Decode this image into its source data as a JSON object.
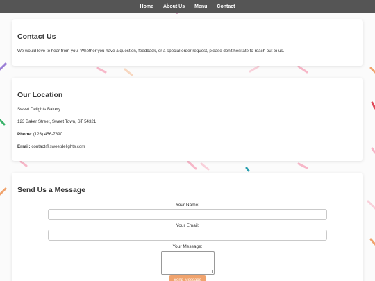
{
  "nav": {
    "items": [
      {
        "label": "Home"
      },
      {
        "label": "About Us"
      },
      {
        "label": "Menu"
      },
      {
        "label": "Contact"
      }
    ]
  },
  "contact": {
    "title": "Contact Us",
    "text": "We would love to hear from you! Whether you have a question, feedback, or a special order request, please don't hesitate to reach out to us."
  },
  "location": {
    "title": "Our Location",
    "name": "Sweet Delights Bakery",
    "address": "123 Baker Street, Sweet Town, ST 54321",
    "phone_label": "Phone:",
    "phone": "(123) 456-7890",
    "email_label": "Email:",
    "email": "contact@sweetdelights.com"
  },
  "message_form": {
    "title": "Send Us a Message",
    "name_label": "Your Name:",
    "name_value": "",
    "email_label": "Your Email:",
    "email_value": "",
    "message_label": "Your Message:",
    "message_value": "",
    "submit_label": "Send Message"
  },
  "colors": {
    "nav_bg": "#555555",
    "accent": "#f0a36d",
    "sprinkle_pink": "#f7b7c8",
    "sprinkle_purple": "#9b7fd6",
    "sprinkle_red": "#e04a5a",
    "sprinkle_teal": "#2a9fb0",
    "sprinkle_green": "#3bb36b",
    "sprinkle_orange": "#f0a36d"
  }
}
